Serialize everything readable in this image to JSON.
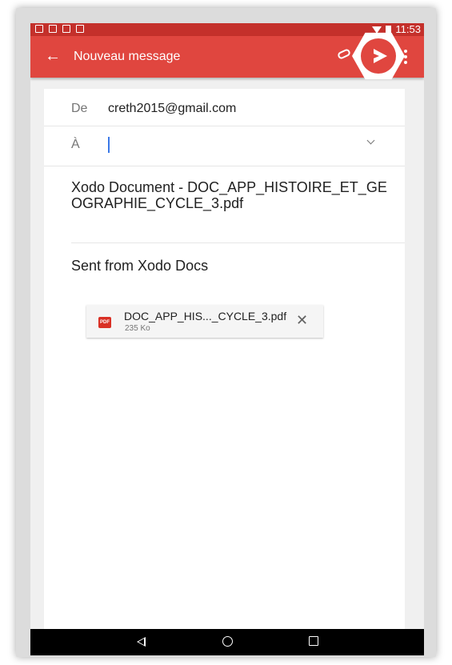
{
  "status_bar": {
    "time": "11:53",
    "notification_icons": [
      "gmail-icon",
      "image-icon",
      "download-icon",
      "edit-icon"
    ]
  },
  "app_bar": {
    "title": "Nouveau message",
    "icons": [
      "back-arrow-icon",
      "attach-icon",
      "send-icon",
      "more-vert-icon"
    ],
    "accent": "#e0463f"
  },
  "compose": {
    "from_label": "De",
    "from_value": "creth2015@gmail.com",
    "to_label": "À",
    "to_value": "",
    "subject": "Xodo Document - DOC_APP_HISTOIRE_ET_GEOGRAPHIE_CYCLE_3.pdf",
    "body": "Sent from Xodo Docs"
  },
  "attachment": {
    "type_badge": "PDF",
    "name": "DOC_APP_HIS..._CYCLE_3.pdf",
    "size": "235 Ko"
  },
  "navigation_bar": {
    "icons": [
      "back-icon",
      "home-icon",
      "recents-icon"
    ]
  }
}
